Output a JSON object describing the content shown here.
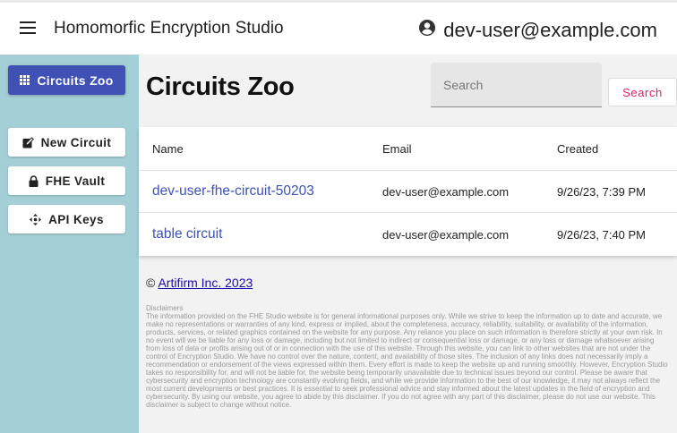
{
  "app": {
    "title": "Homomorfic Encryption Studio",
    "user": "dev-user@example.com"
  },
  "sidebar": {
    "items": [
      {
        "label": "Circuits Zoo",
        "icon": "grid-icon",
        "active": true
      },
      {
        "label": "New Circuit",
        "icon": "edit-square-icon"
      },
      {
        "label": "FHE Vault",
        "icon": "lock-icon"
      },
      {
        "label": "API Keys",
        "icon": "move-arrows-icon"
      }
    ]
  },
  "main": {
    "title": "Circuits Zoo",
    "search": {
      "placeholder": "Search",
      "value": "",
      "button_label": "Search"
    },
    "table": {
      "columns": [
        "Name",
        "Email",
        "Created"
      ],
      "rows": [
        {
          "name": "dev-user-fhe-circuit-50203",
          "email": "dev-user@example.com",
          "created": "9/26/23, 7:39 PM"
        },
        {
          "name": "table circuit",
          "email": "dev-user@example.com",
          "created": "9/26/23, 7:40 PM"
        }
      ]
    }
  },
  "footer": {
    "copyright_symbol": "©",
    "copyright_link": "Artifirm Inc. 2023",
    "disclaimer_title": "Disclaimers",
    "disclaimer_text": "The information provided on the FHE Studio website is for general informational purposes only. While we strive to keep the information up to date and accurate, we make no representations or warranties of any kind, express or implied, about the completeness, accuracy, reliability, suitability, or availability of the information, products, services, or related graphics contained on the website for any purpose. Any reliance you place on such information is therefore strictly at your own risk. In no event will we be liable for any loss or damage, including but not limited to indirect or consequential loss or damage, or any loss or damage whatsoever arising from loss of data or profits arising out of or in connection with the use of this website. Through this website, you can link to other websites that are not under the control of Encryption Studio. We have no control over the nature, content, and availability of those sites. The inclusion of any links does not necessarily imply a recommendation or endorsement of the views expressed within them. Every effort is made to keep the website up and running smoothly. However, Encryption Studio takes no responsibility for, and will not be liable for, the website being temporarily unavailable due to technical issues beyond our control. Please be aware that cybersecurity and encryption technology are constantly evolving fields, and while we provide information to the best of our knowledge, it may not always reflect the most current developments or best practices. It is essential to seek professional advice and stay informed about the latest updates in the field of encryption and cybersecurity. By using our website, you agree to abide by this disclaimer. If you do not agree with any part of this disclaimer, please do not use our website. This disclaimer is subject to change without notice."
  },
  "colors": {
    "primary": "#3f51b5",
    "sidebar_bg": "#a4cfd6",
    "search_accent": "#e91e63",
    "main_bg": "#f2f2f2"
  }
}
